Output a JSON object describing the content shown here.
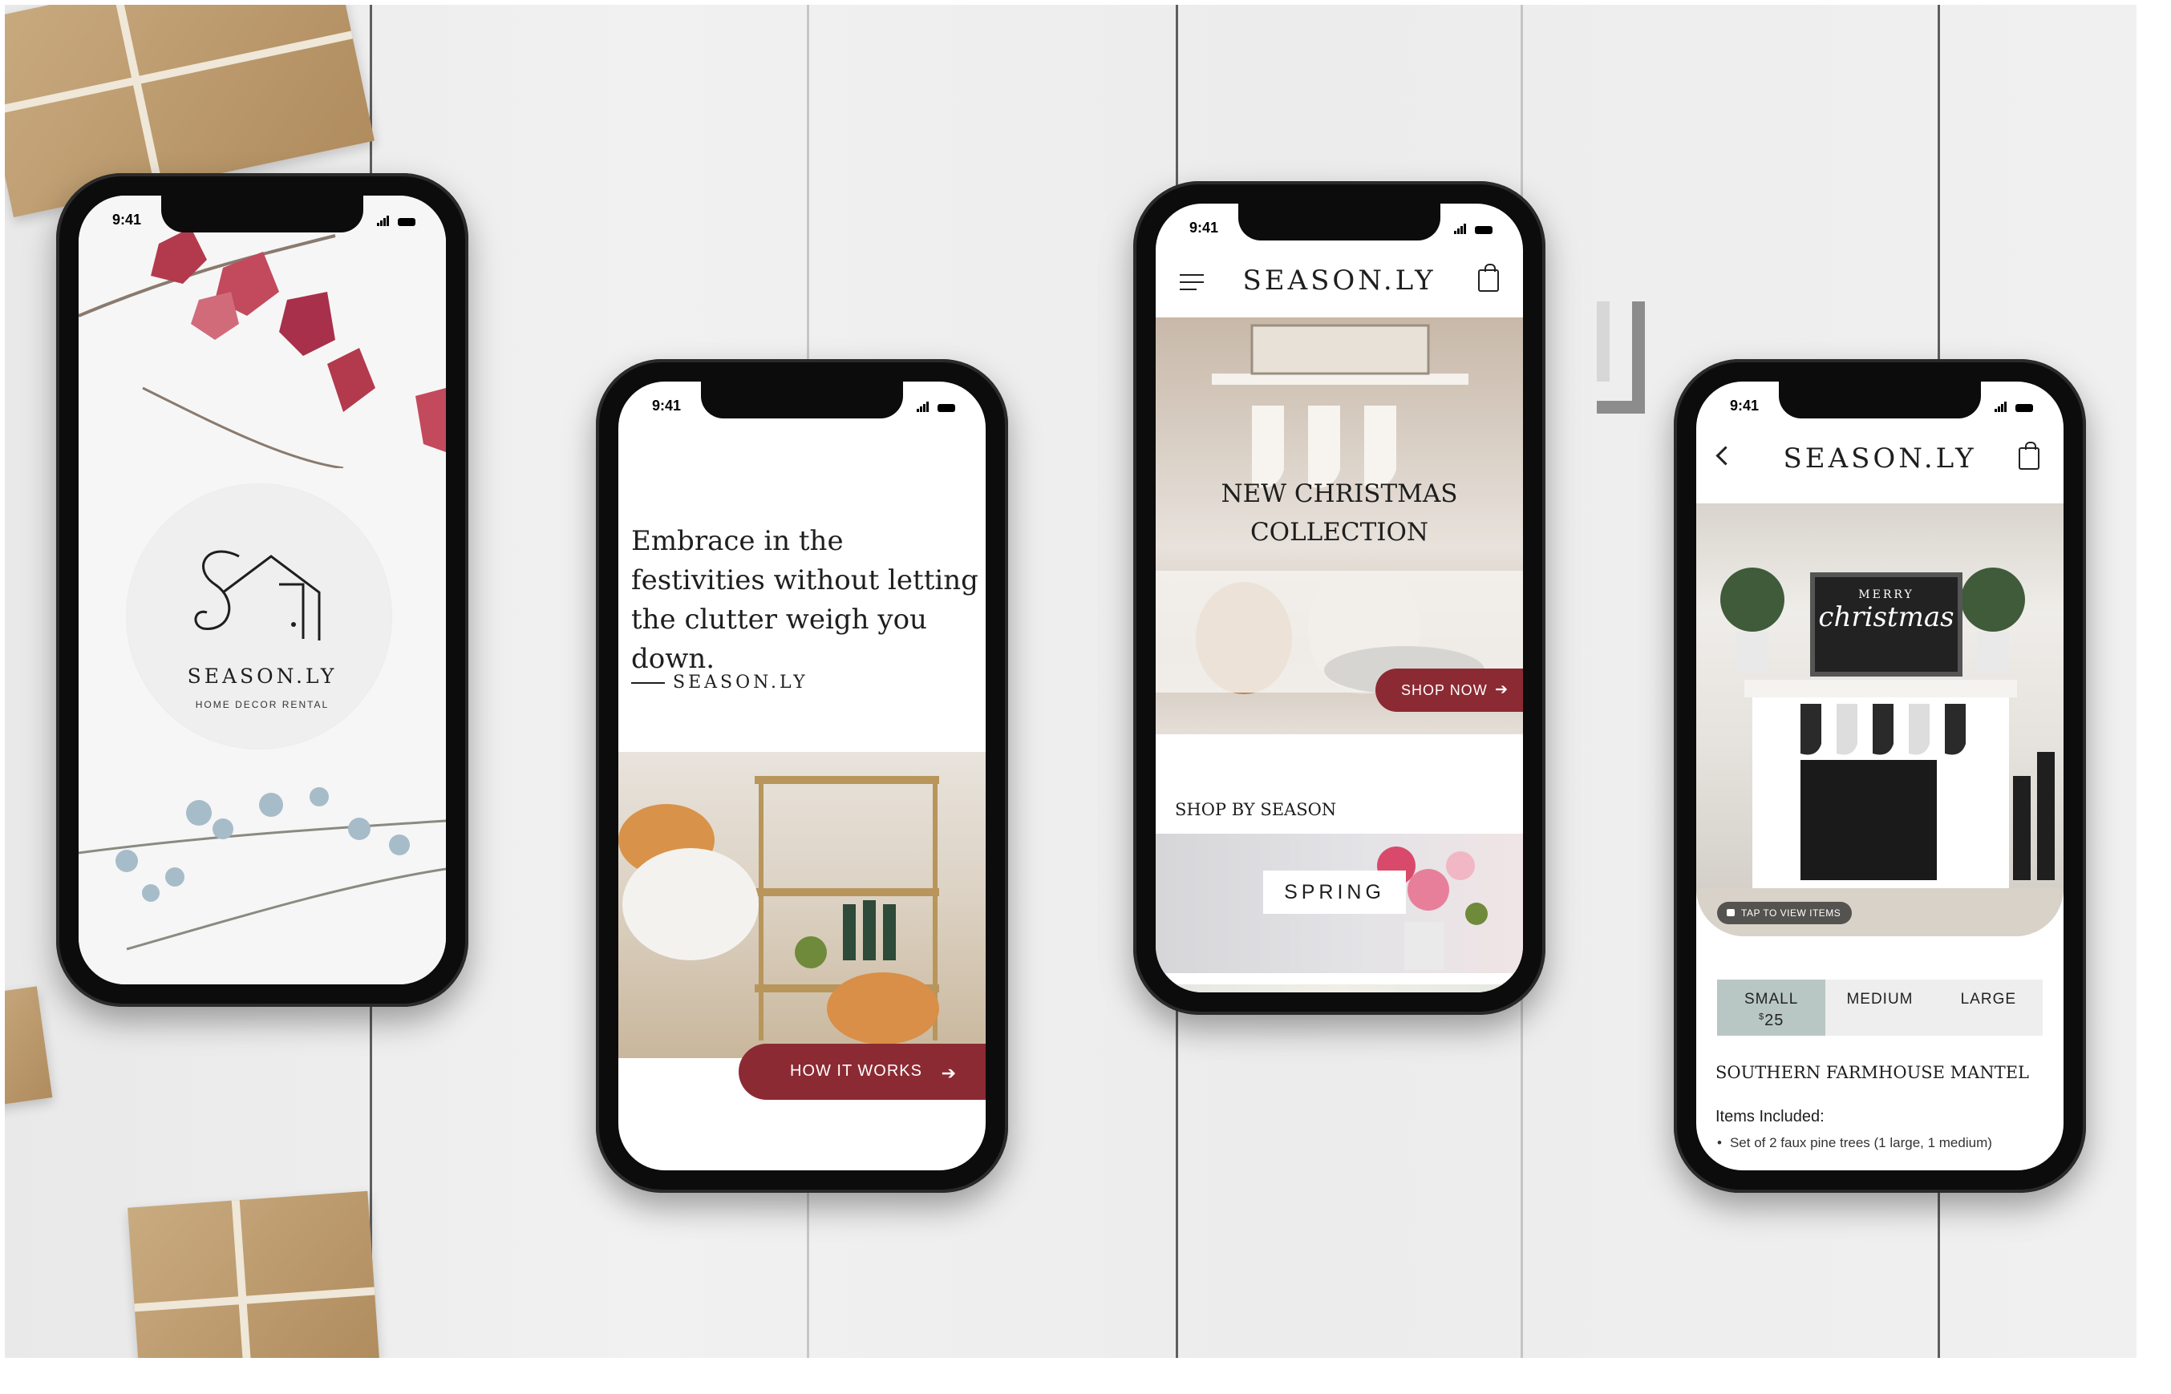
{
  "status": {
    "time": "9:41"
  },
  "phone1": {
    "brand": "SEASON.LY",
    "tagline": "HOME DECOR RENTAL"
  },
  "phone2": {
    "quote": "Embrace in the festivities without letting the clutter weigh you down.",
    "signature": "SEASON.LY",
    "cta_label": "HOW IT WORKS"
  },
  "phone3": {
    "brand": "SEASON.LY",
    "hero_title": "NEW CHRISTMAS\nCOLLECTION",
    "shop_now_label": "SHOP NOW",
    "section_title": "SHOP BY SEASON",
    "season_tiles": [
      {
        "label": "SPRING"
      }
    ]
  },
  "phone4": {
    "brand": "SEASON.LY",
    "tap_hint": "TAP TO VIEW ITEMS",
    "board_text": [
      "MERRY",
      "christmas"
    ],
    "sizes": [
      {
        "label": "SMALL",
        "price": "25",
        "currency": "$",
        "selected": true
      },
      {
        "label": "MEDIUM",
        "selected": false
      },
      {
        "label": "LARGE",
        "selected": false
      }
    ],
    "product_title": "SOUTHERN FARMHOUSE MANTEL",
    "items_heading": "Items Included:",
    "items": [
      "Set of 2 faux pine trees (1 large, 1 medium)"
    ]
  },
  "colors": {
    "accent": "#8c2a33",
    "selected_size": "#b8c7c4"
  },
  "icons": [
    "menu-icon",
    "shopping-bag-icon",
    "back-arrow-icon",
    "arrow-right-icon",
    "lock-icon"
  ]
}
